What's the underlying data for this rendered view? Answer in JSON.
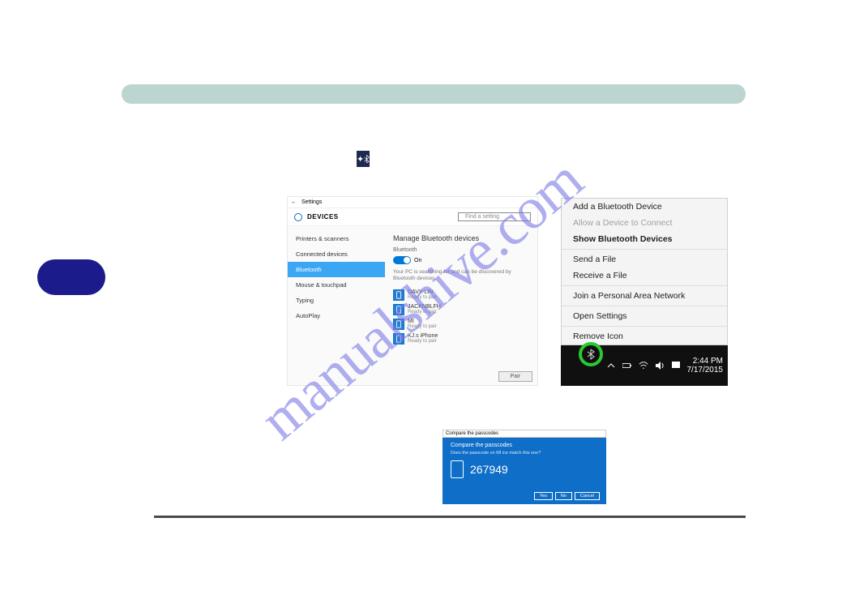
{
  "watermark": "manualshive.com",
  "bt_glyph": "✱",
  "settings": {
    "titlebar_back": "←",
    "titlebar_title": "Settings",
    "header": "DEVICES",
    "search_placeholder": "Find a setting",
    "sidebar": [
      "Printers & scanners",
      "Connected devices",
      "Bluetooth",
      "Mouse & touchpad",
      "Typing",
      "AutoPlay"
    ],
    "main_title": "Manage Bluetooth devices",
    "bt_label": "Bluetooth",
    "toggle_state": "On",
    "hint": "Your PC is searching for and can be discovered by Bluetooth devices.",
    "devices": [
      {
        "name": "DAVY-LIN",
        "status": "Ready to pair"
      },
      {
        "name": "JACKNBLFH",
        "status": "Ready to pair"
      },
      {
        "name": "MI",
        "status": "Ready to pair"
      },
      {
        "name": "KJ.s iPhone",
        "status": "Ready to pair"
      }
    ],
    "pair_label": "Pair"
  },
  "context_menu": {
    "items": [
      {
        "label": "Add a Bluetooth Device",
        "bold": false,
        "disabled": false
      },
      {
        "label": "Allow a Device to Connect",
        "bold": false,
        "disabled": true
      },
      {
        "label": "Show Bluetooth Devices",
        "bold": true,
        "disabled": false
      },
      {
        "sep": true
      },
      {
        "label": "Send a File",
        "bold": false,
        "disabled": false
      },
      {
        "label": "Receive a File",
        "bold": false,
        "disabled": false
      },
      {
        "sep": true
      },
      {
        "label": "Join a Personal Area Network",
        "bold": false,
        "disabled": false
      },
      {
        "sep": true
      },
      {
        "label": "Open Settings",
        "bold": false,
        "disabled": false
      },
      {
        "sep": true
      },
      {
        "label": "Remove Icon",
        "bold": false,
        "disabled": false
      }
    ]
  },
  "taskbar": {
    "time": "2:44 PM",
    "date": "7/17/2015"
  },
  "passcode": {
    "title": "Compare the passcodes",
    "prompt": "Compare the passcodes",
    "sub": "Does the passcode on MI ice match this one?",
    "code": "267949",
    "buttons": [
      "Yes",
      "No",
      "Cancel"
    ]
  }
}
